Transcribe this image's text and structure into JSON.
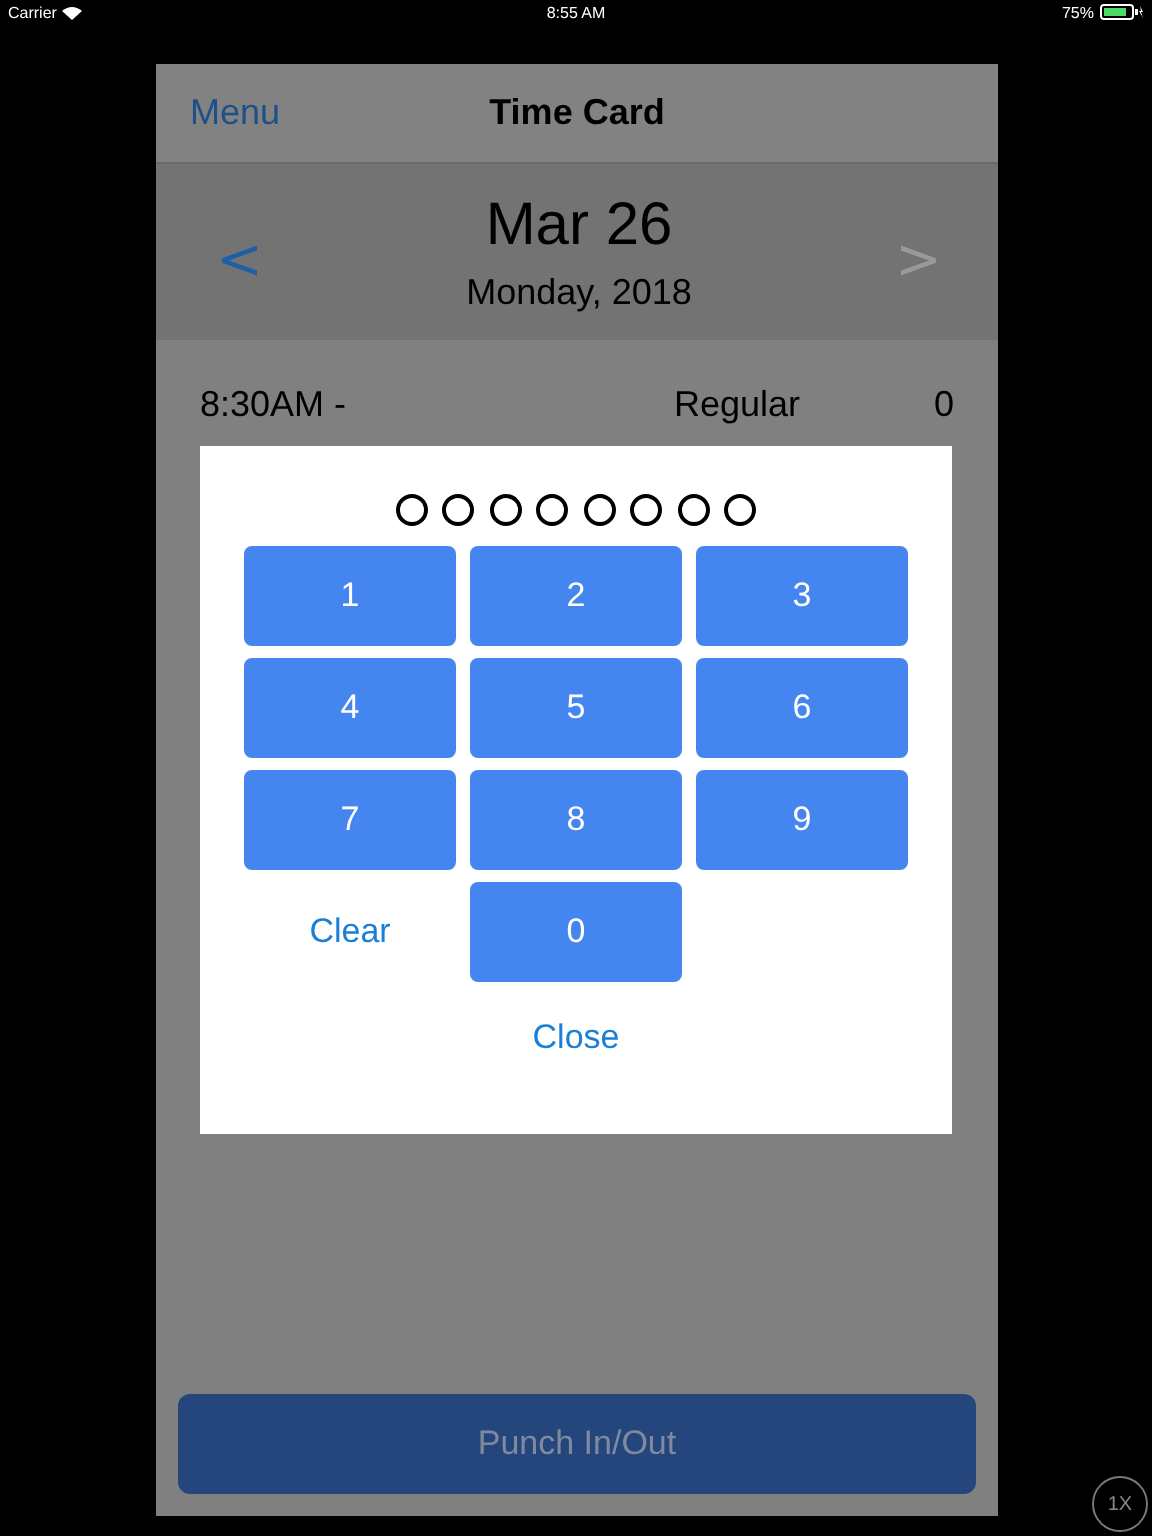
{
  "status_bar": {
    "carrier": "Carrier",
    "time": "8:55 AM",
    "battery": "75%"
  },
  "nav": {
    "menu": "Menu",
    "title": "Time Card"
  },
  "date": {
    "prev": "<",
    "next": ">",
    "next_disabled": true,
    "day": "Mar 26",
    "weekday_year": "Monday, 2018"
  },
  "entries": [
    {
      "time": "8:30AM -",
      "type": "Regular",
      "hours": "0"
    }
  ],
  "pin_pad": {
    "dots": [
      {
        "filled": false
      },
      {
        "filled": false
      },
      {
        "filled": false
      },
      {
        "filled": false
      },
      {
        "filled": false
      },
      {
        "filled": false
      },
      {
        "filled": false
      },
      {
        "filled": false
      }
    ],
    "keys": [
      {
        "kind": "key",
        "label": "1"
      },
      {
        "kind": "key",
        "label": "2"
      },
      {
        "kind": "key",
        "label": "3"
      },
      {
        "kind": "key",
        "label": "4"
      },
      {
        "kind": "key",
        "label": "5"
      },
      {
        "kind": "key",
        "label": "6"
      },
      {
        "kind": "key",
        "label": "7"
      },
      {
        "kind": "key",
        "label": "8"
      },
      {
        "kind": "key",
        "label": "9"
      },
      {
        "kind": "link",
        "label": "Clear"
      },
      {
        "kind": "key",
        "label": "0"
      }
    ],
    "close": "Close"
  },
  "punch_button": "Punch In/Out",
  "zoom_badge": "1X"
}
